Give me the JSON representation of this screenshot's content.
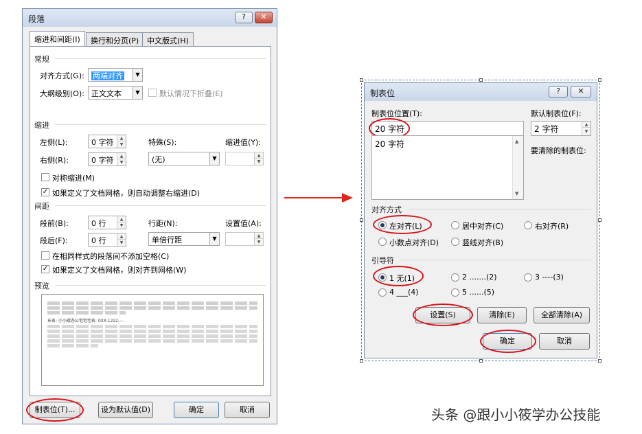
{
  "left_dialog": {
    "title": "段落",
    "help": "?",
    "close": "✕",
    "tabs": [
      {
        "label": "缩进和间距(I)"
      },
      {
        "label": "换行和分页(P)"
      },
      {
        "label": "中文版式(H)"
      }
    ],
    "general": {
      "section": "常规",
      "align_label": "对齐方式(G):",
      "align_value": "两端对齐",
      "outline_label": "大纲级别(O):",
      "outline_value": "正文文本",
      "collapse_label": "默认情况下折叠(E)"
    },
    "indent": {
      "section": "缩进",
      "left_label": "左侧(L):",
      "left_value": "0 字符",
      "right_label": "右侧(R):",
      "right_value": "0 字符",
      "special_label": "特殊(S):",
      "special_value": "(无)",
      "indent_by_label": "缩进值(Y):",
      "mirror_label": "对称缩进(M)",
      "auto_adjust_label": "如果定义了文档网格，则自动调整右缩进(D)"
    },
    "spacing": {
      "section": "间距",
      "before_label": "段前(B):",
      "before_value": "0 行",
      "after_label": "段后(F):",
      "after_value": "0 行",
      "line_label": "行距(N):",
      "line_value": "单倍行距",
      "at_label": "设置值(A):",
      "no_space_label": "在相同样式的段落间不添加空格(C)",
      "snap_grid_label": "如果定义了文档网格，则对齐到网格(W)"
    },
    "preview": {
      "section": "预览",
      "sample": "东名: 小小碳办公宅宅宅名: 0XX-1222----"
    },
    "buttons": {
      "tabs": "制表位(T)...",
      "set_default": "设为默认值(D)",
      "ok": "确定",
      "cancel": "取消"
    }
  },
  "right_dialog": {
    "title": "制表位",
    "help": "?",
    "close": "✕",
    "tab_stop_label": "制表位位置(T):",
    "tab_stop_value": "20 字符",
    "tab_stop_list": [
      "20 字符"
    ],
    "default_label": "默认制表位(F):",
    "default_value": "2 字符",
    "to_clear_label": "要清除的制表位:",
    "alignment": {
      "section": "对齐方式",
      "left": "左对齐(L)",
      "center": "居中对齐(C)",
      "right": "右对齐(R)",
      "decimal": "小数点对齐(D)",
      "bar": "竖线对齐(B)",
      "selected": "left"
    },
    "leader": {
      "section": "引导符",
      "opt1": "1 无(1)",
      "opt2": "2 .......(2)",
      "opt3": "3 ----(3)",
      "opt4": "4 ___(4)",
      "opt5": "5 ......(5)",
      "selected": "1"
    },
    "buttons": {
      "set": "设置(S)",
      "clear": "清除(E)",
      "clear_all": "全部清除(A)",
      "ok": "确定",
      "cancel": "取消"
    }
  },
  "watermark": "头条 @跟小小筱学办公技能",
  "colors": {
    "highlight": "#d8121a",
    "selection": "#3399ff",
    "arrow": "#e0251e"
  }
}
